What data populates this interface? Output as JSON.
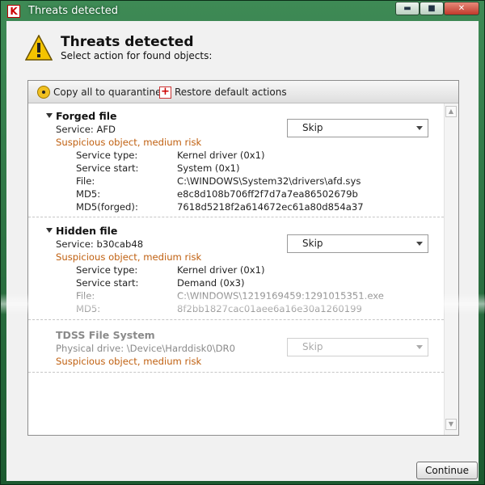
{
  "window": {
    "title": "Threats detected",
    "controls": {
      "minimize": "▬",
      "maximize": "■",
      "close": "✕"
    }
  },
  "header": {
    "title": "Threats detected",
    "subtitle": "Select action for found objects:",
    "icon": "warning-icon"
  },
  "toolbar": {
    "quarantine_label": "Copy all to quarantine",
    "restore_label": "Restore default actions"
  },
  "entries": [
    {
      "name": "Forged file",
      "service": "Service: AFD",
      "risk": "Suspicious object, medium risk",
      "action": "Skip",
      "details": [
        {
          "label": "Service type:",
          "value": "Kernel driver (0x1)"
        },
        {
          "label": "Service start:",
          "value": "System (0x1)"
        },
        {
          "label": "File:",
          "value": "C:\\WINDOWS\\System32\\drivers\\afd.sys"
        },
        {
          "label": "MD5:",
          "value": "e8c8d108b706ff2f7d7a7ea86502679b"
        },
        {
          "label": "MD5(forged):",
          "value": "7618d5218f2a614672ec61a80d854a37"
        }
      ]
    },
    {
      "name": "Hidden file",
      "service": "Service: b30cab48",
      "risk": "Suspicious object, medium risk",
      "action": "Skip",
      "details": [
        {
          "label": "Service type:",
          "value": "Kernel driver (0x1)"
        },
        {
          "label": "Service start:",
          "value": "Demand (0x3)"
        },
        {
          "label": "File:",
          "value": "C:\\WINDOWS\\1219169459:1291015351.exe"
        },
        {
          "label": "MD5:",
          "value": "8f2bb1827cac01aee6a16e30a1260199"
        }
      ]
    },
    {
      "name": "TDSS File System",
      "service": "Physical drive: \\Device\\Harddisk0\\DR0",
      "risk": "Suspicious object, medium risk",
      "action": "Skip"
    }
  ],
  "footer": {
    "continue_label": "Continue"
  },
  "colors": {
    "titlebar": "#2d7a45",
    "risk_text": "#c06010",
    "accent_close": "#c0392b"
  }
}
